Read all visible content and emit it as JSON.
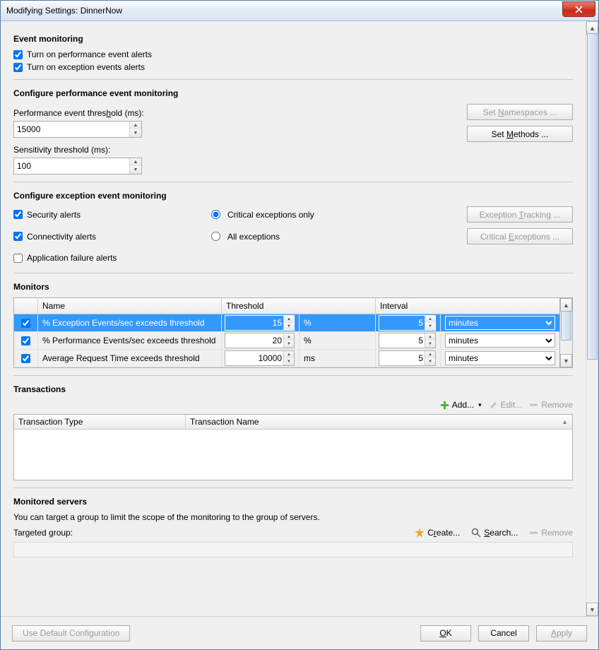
{
  "window": {
    "title": "Modifying Settings: DinnerNow"
  },
  "eventMonitoring": {
    "heading": "Event monitoring",
    "perfAlerts": "Turn on performance event alerts",
    "excAlerts": "Turn on exception events alerts"
  },
  "perf": {
    "heading": "Configure performance event monitoring",
    "thresholdLabel": "Performance event threshold (ms):",
    "thresholdValue": "15000",
    "sensitivityLabel": "Sensitivity threshold (ms):",
    "sensitivityValue": "100",
    "setNamespaces": "Set Namespaces ...",
    "setMethods": "Set Methods ..."
  },
  "exc": {
    "heading": "Configure exception event monitoring",
    "security": "Security alerts",
    "connectivity": "Connectivity alerts",
    "appFailure": "Application failure alerts",
    "criticalOnly": "Critical exceptions only",
    "allExceptions": "All exceptions",
    "tracking": "Exception Tracking ...",
    "criticalBtn": "Critical Exceptions ..."
  },
  "monitors": {
    "heading": "Monitors",
    "cols": {
      "name": "Name",
      "threshold": "Threshold",
      "interval": "Interval"
    },
    "rows": [
      {
        "name": "% Exception Events/sec exceeds threshold",
        "threshold": "15",
        "thUnit": "%",
        "interval": "5",
        "ivUnit": "minutes"
      },
      {
        "name": "% Performance Events/sec exceeds threshold",
        "threshold": "20",
        "thUnit": "%",
        "interval": "5",
        "ivUnit": "minutes"
      },
      {
        "name": "Average Request Time exceeds threshold",
        "threshold": "10000",
        "thUnit": "ms",
        "interval": "5",
        "ivUnit": "minutes"
      }
    ]
  },
  "transactions": {
    "heading": "Transactions",
    "add": "Add...",
    "edit": "Edit...",
    "remove": "Remove",
    "cols": {
      "type": "Transaction Type",
      "name": "Transaction Name"
    }
  },
  "servers": {
    "heading": "Monitored servers",
    "desc": "You can target a group to limit the scope of the monitoring to the group of servers.",
    "targeted": "Targeted group:",
    "create": "Create...",
    "search": "Search...",
    "remove": "Remove"
  },
  "footer": {
    "useDefault": "Use Default Configuration",
    "ok": "OK",
    "cancel": "Cancel",
    "apply": "Apply"
  }
}
